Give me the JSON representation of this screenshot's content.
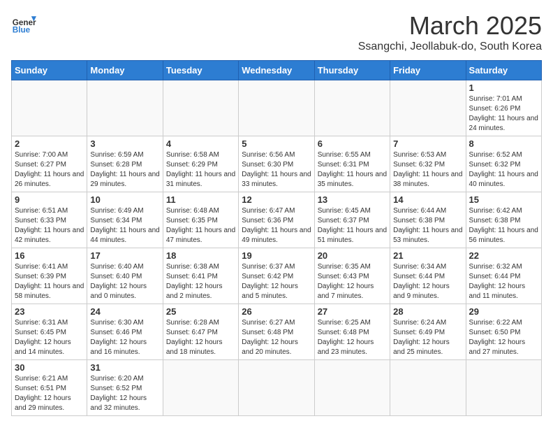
{
  "logo": {
    "text_general": "General",
    "text_blue": "Blue"
  },
  "title": {
    "month_year": "March 2025",
    "location": "Ssangchi, Jeollabuk-do, South Korea"
  },
  "weekdays": [
    "Sunday",
    "Monday",
    "Tuesday",
    "Wednesday",
    "Thursday",
    "Friday",
    "Saturday"
  ],
  "weeks": [
    [
      {
        "day": "",
        "info": ""
      },
      {
        "day": "",
        "info": ""
      },
      {
        "day": "",
        "info": ""
      },
      {
        "day": "",
        "info": ""
      },
      {
        "day": "",
        "info": ""
      },
      {
        "day": "",
        "info": ""
      },
      {
        "day": "1",
        "info": "Sunrise: 7:01 AM\nSunset: 6:26 PM\nDaylight: 11 hours and 24 minutes."
      }
    ],
    [
      {
        "day": "2",
        "info": "Sunrise: 7:00 AM\nSunset: 6:27 PM\nDaylight: 11 hours and 26 minutes."
      },
      {
        "day": "3",
        "info": "Sunrise: 6:59 AM\nSunset: 6:28 PM\nDaylight: 11 hours and 29 minutes."
      },
      {
        "day": "4",
        "info": "Sunrise: 6:58 AM\nSunset: 6:29 PM\nDaylight: 11 hours and 31 minutes."
      },
      {
        "day": "5",
        "info": "Sunrise: 6:56 AM\nSunset: 6:30 PM\nDaylight: 11 hours and 33 minutes."
      },
      {
        "day": "6",
        "info": "Sunrise: 6:55 AM\nSunset: 6:31 PM\nDaylight: 11 hours and 35 minutes."
      },
      {
        "day": "7",
        "info": "Sunrise: 6:53 AM\nSunset: 6:32 PM\nDaylight: 11 hours and 38 minutes."
      },
      {
        "day": "8",
        "info": "Sunrise: 6:52 AM\nSunset: 6:32 PM\nDaylight: 11 hours and 40 minutes."
      }
    ],
    [
      {
        "day": "9",
        "info": "Sunrise: 6:51 AM\nSunset: 6:33 PM\nDaylight: 11 hours and 42 minutes."
      },
      {
        "day": "10",
        "info": "Sunrise: 6:49 AM\nSunset: 6:34 PM\nDaylight: 11 hours and 44 minutes."
      },
      {
        "day": "11",
        "info": "Sunrise: 6:48 AM\nSunset: 6:35 PM\nDaylight: 11 hours and 47 minutes."
      },
      {
        "day": "12",
        "info": "Sunrise: 6:47 AM\nSunset: 6:36 PM\nDaylight: 11 hours and 49 minutes."
      },
      {
        "day": "13",
        "info": "Sunrise: 6:45 AM\nSunset: 6:37 PM\nDaylight: 11 hours and 51 minutes."
      },
      {
        "day": "14",
        "info": "Sunrise: 6:44 AM\nSunset: 6:38 PM\nDaylight: 11 hours and 53 minutes."
      },
      {
        "day": "15",
        "info": "Sunrise: 6:42 AM\nSunset: 6:38 PM\nDaylight: 11 hours and 56 minutes."
      }
    ],
    [
      {
        "day": "16",
        "info": "Sunrise: 6:41 AM\nSunset: 6:39 PM\nDaylight: 11 hours and 58 minutes."
      },
      {
        "day": "17",
        "info": "Sunrise: 6:40 AM\nSunset: 6:40 PM\nDaylight: 12 hours and 0 minutes."
      },
      {
        "day": "18",
        "info": "Sunrise: 6:38 AM\nSunset: 6:41 PM\nDaylight: 12 hours and 2 minutes."
      },
      {
        "day": "19",
        "info": "Sunrise: 6:37 AM\nSunset: 6:42 PM\nDaylight: 12 hours and 5 minutes."
      },
      {
        "day": "20",
        "info": "Sunrise: 6:35 AM\nSunset: 6:43 PM\nDaylight: 12 hours and 7 minutes."
      },
      {
        "day": "21",
        "info": "Sunrise: 6:34 AM\nSunset: 6:44 PM\nDaylight: 12 hours and 9 minutes."
      },
      {
        "day": "22",
        "info": "Sunrise: 6:32 AM\nSunset: 6:44 PM\nDaylight: 12 hours and 11 minutes."
      }
    ],
    [
      {
        "day": "23",
        "info": "Sunrise: 6:31 AM\nSunset: 6:45 PM\nDaylight: 12 hours and 14 minutes."
      },
      {
        "day": "24",
        "info": "Sunrise: 6:30 AM\nSunset: 6:46 PM\nDaylight: 12 hours and 16 minutes."
      },
      {
        "day": "25",
        "info": "Sunrise: 6:28 AM\nSunset: 6:47 PM\nDaylight: 12 hours and 18 minutes."
      },
      {
        "day": "26",
        "info": "Sunrise: 6:27 AM\nSunset: 6:48 PM\nDaylight: 12 hours and 20 minutes."
      },
      {
        "day": "27",
        "info": "Sunrise: 6:25 AM\nSunset: 6:48 PM\nDaylight: 12 hours and 23 minutes."
      },
      {
        "day": "28",
        "info": "Sunrise: 6:24 AM\nSunset: 6:49 PM\nDaylight: 12 hours and 25 minutes."
      },
      {
        "day": "29",
        "info": "Sunrise: 6:22 AM\nSunset: 6:50 PM\nDaylight: 12 hours and 27 minutes."
      }
    ],
    [
      {
        "day": "30",
        "info": "Sunrise: 6:21 AM\nSunset: 6:51 PM\nDaylight: 12 hours and 29 minutes."
      },
      {
        "day": "31",
        "info": "Sunrise: 6:20 AM\nSunset: 6:52 PM\nDaylight: 12 hours and 32 minutes."
      },
      {
        "day": "",
        "info": ""
      },
      {
        "day": "",
        "info": ""
      },
      {
        "day": "",
        "info": ""
      },
      {
        "day": "",
        "info": ""
      },
      {
        "day": "",
        "info": ""
      }
    ]
  ]
}
